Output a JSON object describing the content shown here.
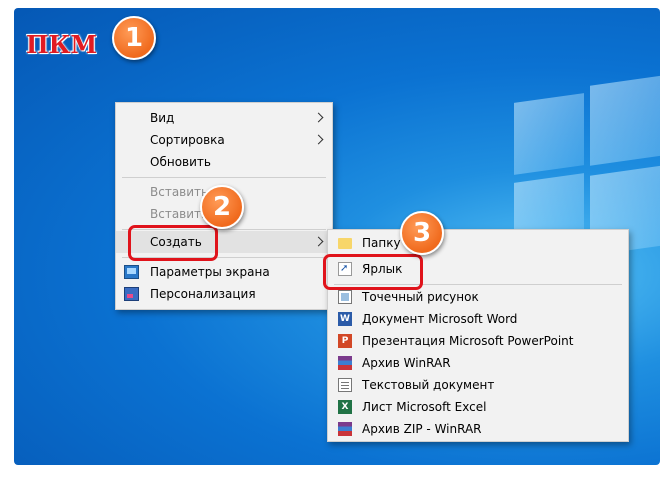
{
  "annotation": {
    "label": "ПКМ",
    "step1": "1",
    "step2": "2",
    "step3": "3",
    "highlight_color": "#e0131b",
    "badge_color": "#f06a1d"
  },
  "context_menu": {
    "items": [
      {
        "label": "Вид",
        "has_submenu": true,
        "enabled": true
      },
      {
        "label": "Сортировка",
        "has_submenu": true,
        "enabled": true
      },
      {
        "label": "Обновить",
        "enabled": true
      },
      {
        "label": "Вставить",
        "enabled": false
      },
      {
        "label": "Вставить",
        "enabled": false
      },
      {
        "label": "Создать",
        "has_submenu": true,
        "enabled": true,
        "highlighted": true
      },
      {
        "label": "Параметры экрана",
        "icon": "display-settings-icon",
        "enabled": true
      },
      {
        "label": "Персонализация",
        "icon": "personalization-icon",
        "enabled": true
      }
    ]
  },
  "create_submenu": {
    "items": [
      {
        "label": "Папку",
        "icon": "folder-icon"
      },
      {
        "label": "Ярлык",
        "icon": "shortcut-icon"
      },
      {
        "label": "Точечный рисунок",
        "icon": "bitmap-icon"
      },
      {
        "label": "Документ Microsoft Word",
        "icon": "word-icon",
        "glyph": "W"
      },
      {
        "label": "Презентация Microsoft PowerPoint",
        "icon": "powerpoint-icon",
        "glyph": "P"
      },
      {
        "label": "Архив WinRAR",
        "icon": "winrar-icon"
      },
      {
        "label": "Текстовый документ",
        "icon": "text-document-icon"
      },
      {
        "label": "Лист Microsoft Excel",
        "icon": "excel-icon",
        "glyph": "X"
      },
      {
        "label": "Архив ZIP - WinRAR",
        "icon": "winrar-zip-icon"
      }
    ]
  }
}
